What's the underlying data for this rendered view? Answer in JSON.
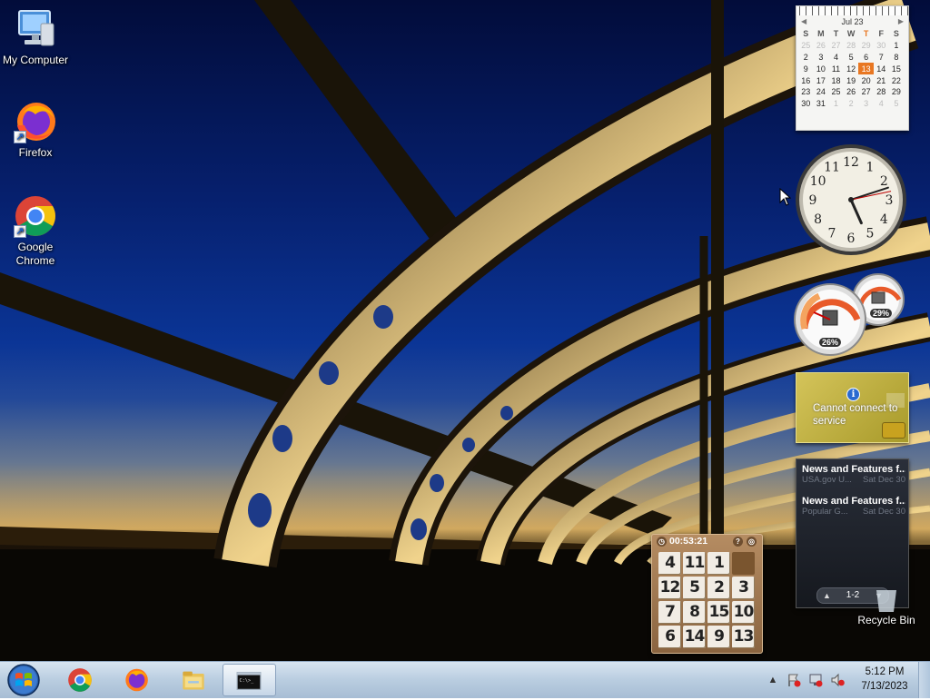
{
  "desktop": {
    "icons": [
      {
        "label": "My Computer",
        "icon": "computer-icon"
      },
      {
        "label": "Firefox",
        "icon": "firefox-icon"
      },
      {
        "label": "Google Chrome",
        "icon": "chrome-icon"
      },
      {
        "label": "Recycle Bin",
        "icon": "recycle-bin-icon"
      }
    ]
  },
  "gadgets": {
    "calendar": {
      "month_label": "Jul 23",
      "weekdays": [
        "S",
        "M",
        "T",
        "W",
        "T",
        "F",
        "S"
      ],
      "weeks": [
        [
          "25",
          "26",
          "27",
          "28",
          "29",
          "30",
          "1"
        ],
        [
          "2",
          "3",
          "4",
          "5",
          "6",
          "7",
          "8"
        ],
        [
          "9",
          "10",
          "11",
          "12",
          "13",
          "14",
          "15"
        ],
        [
          "16",
          "17",
          "18",
          "19",
          "20",
          "21",
          "22"
        ],
        [
          "23",
          "24",
          "25",
          "26",
          "27",
          "28",
          "29"
        ],
        [
          "30",
          "31",
          "1",
          "2",
          "3",
          "4",
          "5"
        ]
      ],
      "today": "13",
      "today_weekday_index": 4
    },
    "clock": {
      "numerals": [
        "12",
        "1",
        "2",
        "3",
        "4",
        "5",
        "6",
        "7",
        "8",
        "9",
        "10",
        "11"
      ],
      "hour": 5,
      "minute": 12,
      "second": 13
    },
    "cpu_meter": {
      "cpu_percent": "26%",
      "memory_percent": "29%"
    },
    "currency": {
      "message": "Cannot connect to service",
      "info_icon": "info-icon"
    },
    "feeds": {
      "items": [
        {
          "title": "News and Features f...",
          "source": "USA.gov U...",
          "date": "Sat Dec 30"
        },
        {
          "title": "News and Features f...",
          "source": "Popular G...",
          "date": "Sat Dec 30"
        }
      ],
      "page_label": "1-2"
    },
    "puzzle": {
      "timer": "00:53:21",
      "tiles": [
        "4",
        "11",
        "1",
        "",
        "12",
        "5",
        "2",
        "3",
        "7",
        "8",
        "15",
        "10",
        "6",
        "14",
        "9",
        "13"
      ]
    }
  },
  "taskbar": {
    "start_icon": "windows-start-icon",
    "pinned": [
      {
        "icon": "chrome-icon",
        "active": false
      },
      {
        "icon": "firefox-icon",
        "active": false
      },
      {
        "icon": "file-explorer-icon",
        "active": false
      },
      {
        "icon": "command-prompt-icon",
        "active": true
      }
    ],
    "tray": {
      "time": "5:12 PM",
      "date": "7/13/2023"
    }
  },
  "colors": {
    "accent_today": "#e87722",
    "taskbar": "#b9cde0"
  }
}
